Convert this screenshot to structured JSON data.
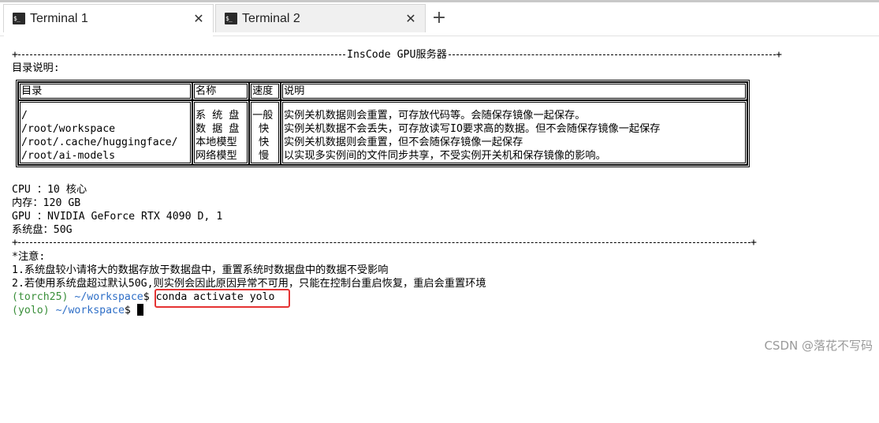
{
  "tabs": [
    {
      "label": "Terminal 1",
      "icon": "terminal-icon",
      "active": true
    },
    {
      "label": "Terminal 2",
      "icon": "terminal-icon",
      "active": false
    }
  ],
  "tab_close_glyph": "✕",
  "new_tab_glyph": "+",
  "terminal_icon_text": "$_",
  "banner": {
    "title": "InsCode GPU服务器",
    "dir_heading": "目录说明:",
    "table": {
      "headers": [
        "目录",
        "名称",
        "速度",
        "说明"
      ],
      "rows": [
        [
          "/",
          "系 统 盘",
          "一般",
          "实例关机数据则会重置，可存放代码等。会随保存镜像一起保存。"
        ],
        [
          "/root/workspace",
          "数 据 盘",
          " 快 ",
          "实例关机数据不会丢失，可存放读写IO要求高的数据。但不会随保存镜像一起保存"
        ],
        [
          "/root/.cache/huggingface/",
          "本地模型",
          " 快 ",
          "实例关机数据则会重置，但不会随保存镜像一起保存"
        ],
        [
          "/root/ai-models",
          "网络模型",
          " 慢 ",
          "以实现多实例间的文件同步共享，不受实例开关机和保存镜像的影响。"
        ]
      ]
    },
    "specs": [
      "CPU ：10 核心",
      "内存：120 GB",
      "GPU ：NVIDIA GeForce RTX 4090 D, 1",
      "系统盘：50G"
    ],
    "notes": [
      "*注意:",
      "1.系统盘较小请将大的数据存放于数据盘中，重置系统时数据盘中的数据不受影响",
      "2.若使用系统盘超过默认50G,则实例会因此原因异常不可用，只能在控制台重启恢复，重启会重置环境"
    ]
  },
  "prompts": [
    {
      "env": "(torch25)",
      "dir": " ~/workspace",
      "symbol": "$",
      "command": " conda activate yolo"
    },
    {
      "env": "(yolo)",
      "dir": " ~/workspace",
      "symbol": "$",
      "command": " "
    }
  ],
  "highlight_color": "#e53333",
  "watermark": "CSDN @落花不写码"
}
